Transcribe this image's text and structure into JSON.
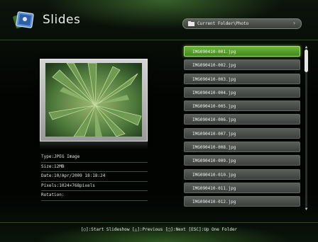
{
  "header": {
    "title": "Slides",
    "folder_path": "Current Folder\\Photo"
  },
  "info": {
    "type": "Type:JPEG Image",
    "size": "Size:12MB",
    "date": "Date:10/Apr/2009 18:18:24",
    "pixels": "Pixels:1024×768pixels",
    "rotation": "Rotation:"
  },
  "files": [
    "IMG090410-001.jpg",
    "IMG090410-002.jpg",
    "IMG090410-003.jpg",
    "IMG090410-004.jpg",
    "IMG090410-005.jpg",
    "IMG090410-006.jpg",
    "IMG090410-007.jpg",
    "IMG090410-008.jpg",
    "IMG090410-009.jpg",
    "IMG090410-010.jpg",
    "IMG090410-011.jpg",
    "IMG090410-012.jpg"
  ],
  "selected_index": 0,
  "footer": {
    "hint": "[○]:Start Slideshow  [△]:Previous  [□]:Next  [ESC]:Up One Folder"
  },
  "colors": {
    "accent": "#5fa82e",
    "background": "#050805"
  },
  "icons": {
    "app": "photo-stack-icon",
    "folder": "folder-icon",
    "chevron": "chevron-right-icon"
  }
}
